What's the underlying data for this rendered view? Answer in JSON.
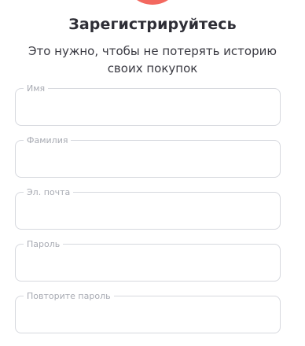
{
  "header": {
    "title": "Зарегистрируйтесь",
    "subtitle": "Это нужно, чтобы не потерять историю своих покупок",
    "accent_color": "#f3685f"
  },
  "form": {
    "fields": [
      {
        "label": "Имя",
        "value": ""
      },
      {
        "label": "Фамилия",
        "value": ""
      },
      {
        "label": "Эл. почта",
        "value": ""
      },
      {
        "label": "Пароль",
        "value": ""
      },
      {
        "label": "Повторите пароль",
        "value": ""
      }
    ]
  }
}
